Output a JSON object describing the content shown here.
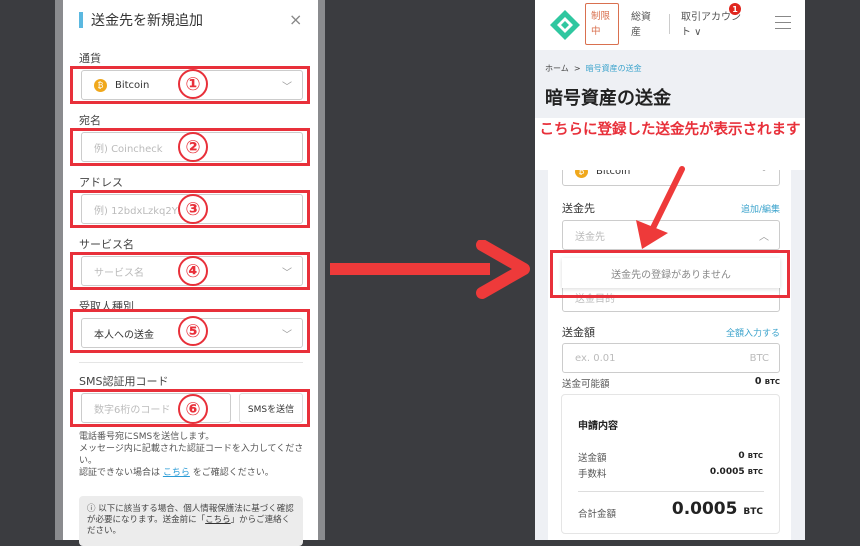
{
  "modal": {
    "title": "送金先を新規追加",
    "close_icon": "×",
    "fields": [
      {
        "label": "通貨",
        "value": "Bitcoin",
        "marker": "①"
      },
      {
        "label": "宛名",
        "placeholder": "例) Coincheck",
        "marker": "②"
      },
      {
        "label": "アドレス",
        "placeholder": "例) 12bdxLzkq2YZz...",
        "marker": "③"
      },
      {
        "label": "サービス名",
        "placeholder": "サービス名",
        "marker": "④"
      },
      {
        "label": "受取人種別",
        "value": "本人への送金",
        "marker": "⑤"
      }
    ],
    "sms": {
      "label": "SMS認証用コード",
      "placeholder": "数字6桁のコード",
      "button": "SMSを送信",
      "marker": "⑥",
      "note1": "電話番号宛にSMSを送信します。",
      "note2": "メッセージ内に記載された認証コードを入力してください。",
      "note3_pre": "認証できない場合は",
      "note3_link": "こちら",
      "note3_post": "をご確認ください。"
    },
    "info": {
      "pre": "以下に該当する場合、個人情報保護法に基づく確認が必要になります。送金前に「",
      "link": "こちら",
      "post": "」からご連絡ください。"
    }
  },
  "phone": {
    "header": {
      "limit_badge": "制限中",
      "total_assets": "総資産",
      "account": "取引アカウント ∨",
      "notification_count": "1"
    },
    "breadcrumb": {
      "home": "ホーム",
      "sep": ">",
      "current": "暗号資産の送金"
    },
    "page_title": "暗号資産の送金",
    "callout": "こちらに登録した送金先が表示されます",
    "currency_value": "Bitcoin",
    "destination": {
      "label": "送金先",
      "link": "追加/編集",
      "placeholder": "送金先",
      "empty": "送金先の登録がありません",
      "purpose_placeholder": "送金目的"
    },
    "amount": {
      "label": "送金額",
      "link": "全額入力する",
      "placeholder": "ex. 0.01",
      "unit": "BTC",
      "available_label": "送金可能額",
      "available_value": "0",
      "available_unit": "BTC"
    },
    "summary": {
      "title": "申請内容",
      "rows": [
        {
          "label": "送金額",
          "value": "0",
          "unit": "BTC"
        },
        {
          "label": "手数料",
          "value": "0.0005",
          "unit": "BTC"
        }
      ],
      "total_label": "合計金額",
      "total_value": "0.0005",
      "total_unit": "BTC"
    }
  },
  "colors": {
    "highlight": "#e8303a",
    "accent": "#3ba3cc",
    "brand": "#2fc7a0"
  }
}
